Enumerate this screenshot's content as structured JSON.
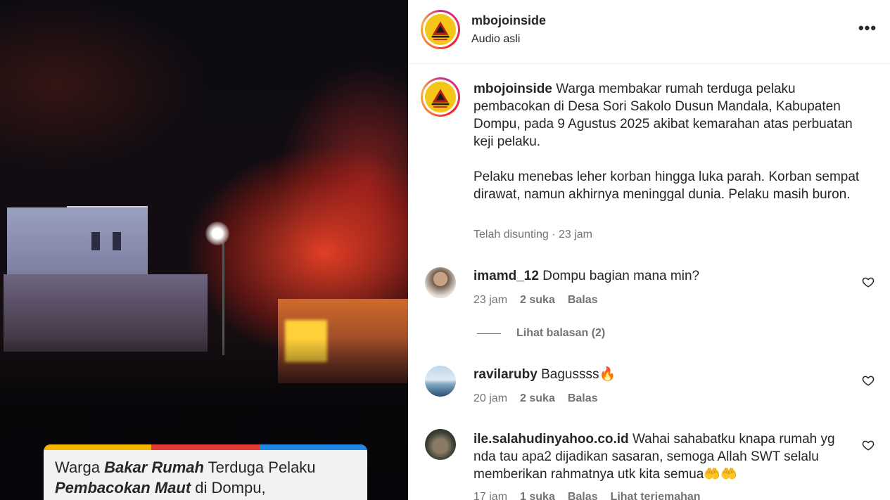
{
  "video": {
    "caption_parts": [
      {
        "text": "Warga ",
        "bold": false
      },
      {
        "text": "Bakar Rumah",
        "bold": true
      },
      {
        "text": " Terduga Pelaku",
        "bold": false
      },
      {
        "text": "Pembacokan Maut",
        "bold": true
      },
      {
        "text": " di Dompu,",
        "bold": false
      }
    ],
    "caption_bar_colors": [
      "#f4b400",
      "#e53935",
      "#1e88e5"
    ]
  },
  "header": {
    "username": "mbojoinside",
    "audio": "Audio asli",
    "more_icon": "more-horizontal-icon"
  },
  "post": {
    "username": "mbojoinside",
    "paragraph1": "Warga membakar rumah terduga pelaku pembacokan di Desa Sori Sakolo Dusun Mandala, Kabupaten Dompu, pada 9 Agustus 2025 akibat kemarahan atas perbuatan keji pelaku.",
    "paragraph2": "Pelaku menebas leher korban hingga luka parah. Korban sempat dirawat, namun akhirnya meninggal dunia. Pelaku masih buron.",
    "edited": "Telah disunting",
    "separator": "·",
    "time": "23 jam"
  },
  "comments": [
    {
      "username": "imamd_12",
      "text": "Dompu bagian mana min?",
      "time": "23 jam",
      "likes": "2 suka",
      "reply": "Balas",
      "view_replies": "Lihat balasan (2)"
    },
    {
      "username": "ravilaruby",
      "text": "Bagussss🔥",
      "time": "20 jam",
      "likes": "2 suka",
      "reply": "Balas"
    },
    {
      "username": "ile.salahudinyahoo.co.id",
      "text": "Wahai sahabatku knapa rumah yg nda tau apa2 dijadikan sasaran, semoga Allah SWT selalu memberikan rahmatnya utk kita semua🤲🤲",
      "time": "17 jam",
      "likes": "1 suka",
      "reply": "Balas",
      "translate": "Lihat terjemahan"
    }
  ],
  "colors": {
    "text": "#262626",
    "muted": "#737373",
    "logo_yellow": "#f5c518"
  }
}
